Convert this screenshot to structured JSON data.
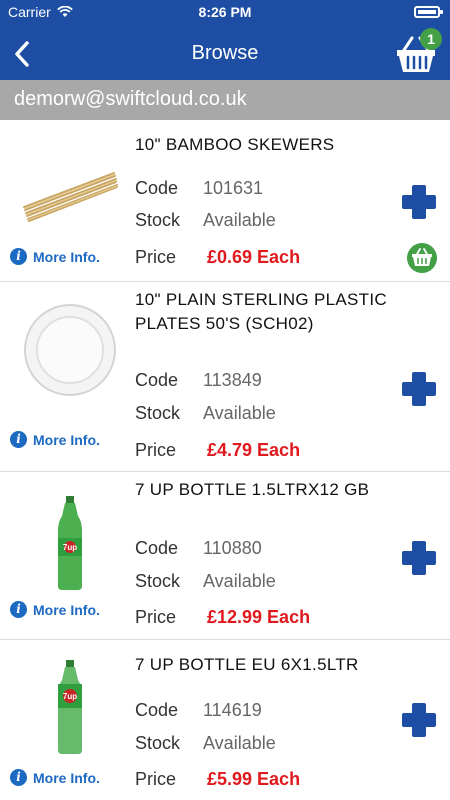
{
  "status": {
    "carrier": "Carrier",
    "time": "8:26 PM"
  },
  "nav": {
    "title": "Browse",
    "basket_count": "1"
  },
  "account": {
    "email": "demorw@swiftcloud.co.uk"
  },
  "labels": {
    "code": "Code",
    "stock": "Stock",
    "price": "Price",
    "more_info": "More Info."
  },
  "colors": {
    "header": "#1d4ea3",
    "price": "#e0191e",
    "add_button": "#1d4ea3",
    "basket_green": "#43a047"
  },
  "products": [
    {
      "title": "10\" BAMBOO SKEWERS",
      "code": "101631",
      "stock": "Available",
      "price": "£0.69 Each",
      "in_basket": true,
      "image": "bamboo-skewers"
    },
    {
      "title": "10\" PLAIN STERLING PLASTIC PLATES 50'S (SCH02)",
      "code": "113849",
      "stock": "Available",
      "price": "£4.79 Each",
      "in_basket": false,
      "image": "plastic-plate"
    },
    {
      "title": "7 UP BOTTLE 1.5LTRX12 GB",
      "code": "110880",
      "stock": "Available",
      "price": "£12.99 Each",
      "in_basket": false,
      "image": "7up-bottle"
    },
    {
      "title": "7 UP BOTTLE EU 6X1.5LTR",
      "code": "114619",
      "stock": "Available",
      "price": "£5.99 Each",
      "in_basket": false,
      "image": "7up-bottle"
    }
  ]
}
